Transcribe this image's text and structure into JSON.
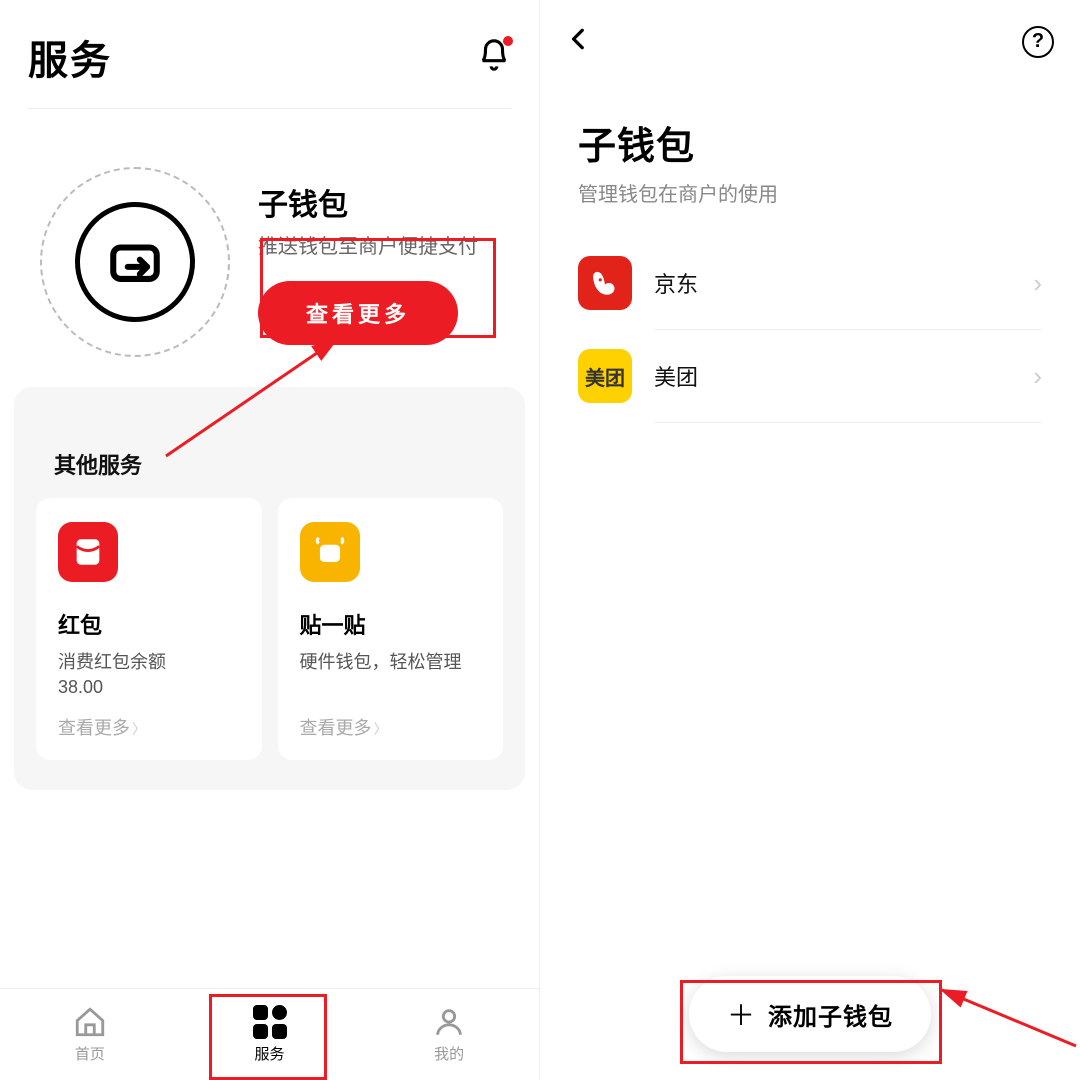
{
  "left": {
    "header": {
      "title": "服务"
    },
    "wallet": {
      "title": "子钱包",
      "subtitle": "推送钱包至商户便捷支付",
      "button": "查看更多"
    },
    "other_section_title": "其他服务",
    "cards": [
      {
        "title": "红包",
        "desc1": "消费红包余额",
        "desc2": "38.00",
        "more": "查看更多"
      },
      {
        "title": "贴一贴",
        "desc1": "硬件钱包，轻松管理",
        "desc2": "",
        "more": "查看更多"
      }
    ],
    "tabs": [
      {
        "label": "首页"
      },
      {
        "label": "服务"
      },
      {
        "label": "我的"
      }
    ]
  },
  "right": {
    "title": "子钱包",
    "subtitle": "管理钱包在商户的使用",
    "merchants": [
      {
        "name": "京东",
        "tag": "京东"
      },
      {
        "name": "美团",
        "tag": "美团"
      }
    ],
    "add_button": "添加子钱包"
  }
}
